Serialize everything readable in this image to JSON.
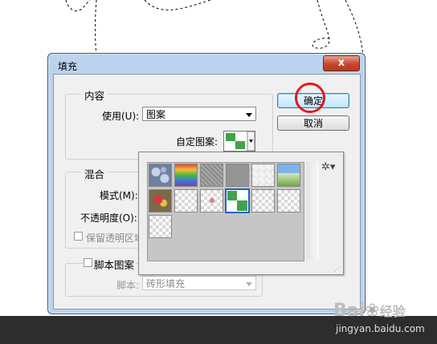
{
  "dialog": {
    "title": "填充",
    "close_label": "x",
    "content_group": "内容",
    "use_label": "使用(U):",
    "use_value": "图案",
    "custom_pattern_label": "自定图案:",
    "blend_group": "混合",
    "mode_label": "模式(M):",
    "opacity_label": "不透明度(O):",
    "preserve_label": "保留透明区域",
    "script_label": "脚本图案",
    "script_name_label": "脚本:",
    "script_value": "砖形填充",
    "ok_label": "确定",
    "cancel_label": "取消"
  },
  "pattern_picker": {
    "menu_icon": "gear-icon",
    "patterns": [
      "bubbles",
      "tie-dye",
      "gray-granite",
      "gray-fabric",
      "white-checker",
      "grass-photo",
      "flowers-photo",
      "transparent-1",
      "transparent-pink",
      "green-checker",
      "transparent-2",
      "transparent-3",
      "moon-star"
    ],
    "selected": "green-checker"
  },
  "watermark": {
    "brand": "Bai",
    "brand_cn": "经验",
    "url": "jingyan.baidu.com"
  },
  "colors": {
    "accent": "#3c7fb1",
    "highlight_circle": "#e21a1a",
    "pattern_green": "#3fa34d"
  }
}
